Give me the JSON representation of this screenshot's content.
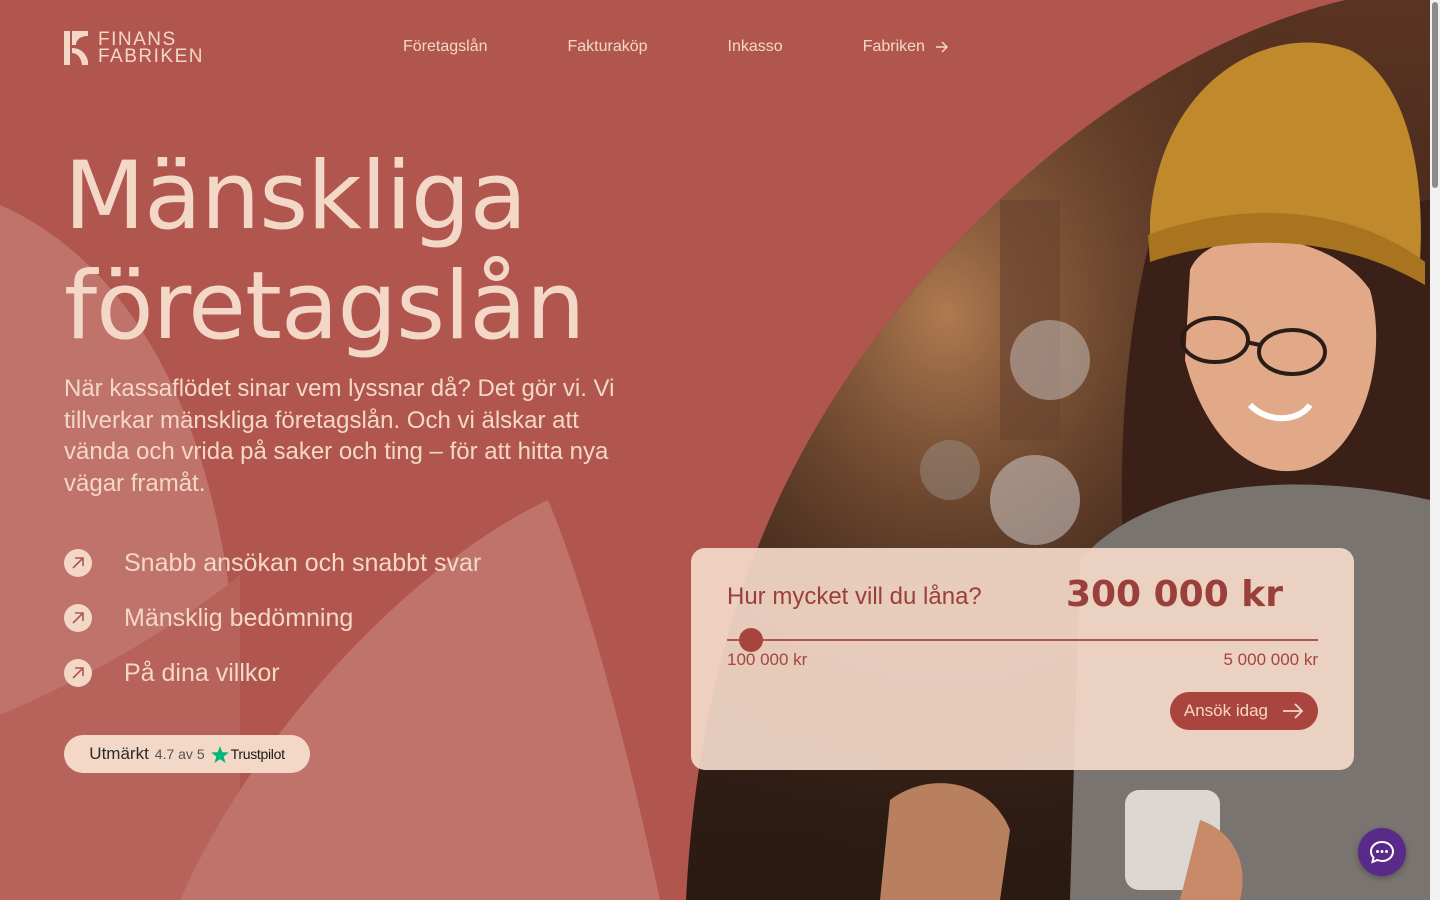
{
  "logo": {
    "line1": "FINANS",
    "line2": "FABRIKEN"
  },
  "nav": {
    "items": [
      {
        "label": "Företagslån"
      },
      {
        "label": "Fakturaköp"
      },
      {
        "label": "Inkasso"
      },
      {
        "label": "Fabriken",
        "icon": "arrow-right-icon"
      }
    ]
  },
  "hero": {
    "title_line1": "Mänskliga",
    "title_line2": "företagslån",
    "text": "När kassaflödet sinar vem lyssnar då? Det gör vi. Vi tillverkar mänskliga företagslån. Och vi älskar att vända och vrida på saker och ting – för att hitta nya vägar framåt."
  },
  "features": [
    {
      "label": "Snabb ansökan och snabbt svar",
      "icon": "arrow-up-right-icon"
    },
    {
      "label": "Mänsklig bedömning",
      "icon": "arrow-up-right-icon"
    },
    {
      "label": "På dina villkor",
      "icon": "arrow-up-right-icon"
    }
  ],
  "trustpilot": {
    "rating_word": "Utmärkt",
    "score": "4.7 av 5",
    "brand": "Trustpilot"
  },
  "loan_calculator": {
    "question": "Hur mycket vill du låna?",
    "amount": "300 000 kr",
    "min_label": "100 000 kr",
    "max_label": "5 000 000 kr",
    "slider_fraction": 0.0408,
    "apply_label": "Ansök idag"
  },
  "colors": {
    "background": "#b1564e",
    "cream": "#f3d8c8",
    "accent_dark": "#a9443e",
    "chat": "#5a2a8a"
  }
}
